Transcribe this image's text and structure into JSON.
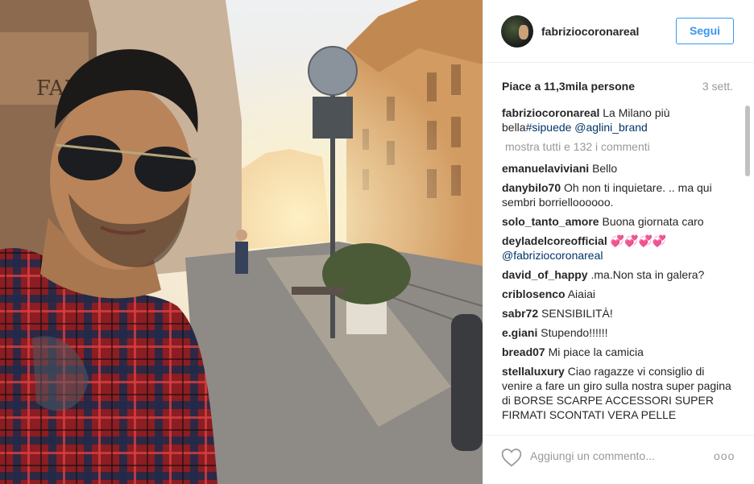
{
  "post": {
    "username": "fabriziocoronareal",
    "follow_label": "Segui",
    "likes_text": "Piace a 11,3mila persone",
    "age": "3 sett.",
    "photo_sign": "FARC"
  },
  "caption": {
    "user": "fabriziocoronareal",
    "text": "La Milano più bella",
    "tags": "#sipuede @aglini_brand"
  },
  "more_comments": "mostra tutti e 132 i commenti",
  "comments": [
    {
      "user": "emanuelaviviani",
      "text": "Bello"
    },
    {
      "user": "danybilo70",
      "text": "Oh non ti inquietare. .. ma qui sembri borrielloooooo."
    },
    {
      "user": "solo_tanto_amore",
      "text": "Buona giornata caro"
    },
    {
      "user": "deyladelcoreofficial",
      "text": "💞💞💞💞",
      "tag": "@fabriziocoronareal"
    },
    {
      "user": "david_of_happy",
      "text": ".ma.Non sta in galera?"
    },
    {
      "user": "criblosenco",
      "text": "Aiaiai"
    },
    {
      "user": "sabr72",
      "text": "SENSIBILITÀ!"
    },
    {
      "user": "e.giani",
      "text": "Stupendo!!!!!!"
    },
    {
      "user": "bread07",
      "text": "Mi piace la camicia"
    },
    {
      "user": "stellaluxury",
      "text": "Ciao ragazze vi consiglio di venire a fare un giro sulla nostra super pagina di BORSE SCARPE ACCESSORI SUPER FIRMATI SCONTATI VERA PELLE"
    }
  ],
  "footer": {
    "add_comment_placeholder": "Aggiungi un commento...",
    "more_label": "ooo"
  },
  "icons": {
    "like": "heart-outline-icon",
    "options": "more-options-icon"
  },
  "colors": {
    "accent": "#3897f0",
    "hashtag": "#003569",
    "muted": "#999999"
  }
}
